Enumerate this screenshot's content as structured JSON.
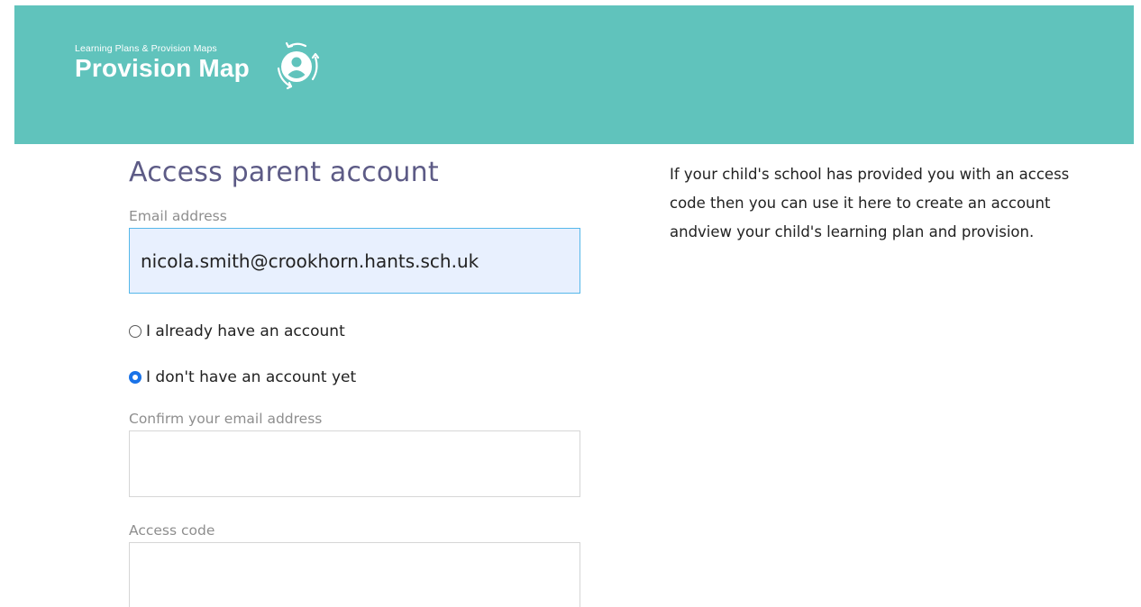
{
  "header": {
    "logo_tagline": "Learning Plans & Provision Maps",
    "logo_title": "Provision Map",
    "background_color": "#60c3bc"
  },
  "form": {
    "title": "Access parent account",
    "email_label": "Email address",
    "email_value": "nicola.smith@crookhorn.hants.sch.uk",
    "account_options": [
      {
        "label": "I already have an account",
        "selected": false
      },
      {
        "label": "I don't have an account yet",
        "selected": true
      }
    ],
    "confirm_email_label": "Confirm your email address",
    "confirm_email_value": "",
    "access_code_label": "Access code",
    "access_code_value": ""
  },
  "info": {
    "lines": [
      "If your child's school has provided you with an access",
      "code then you can use it here to create an account",
      "andview your child's learning plan and provision."
    ]
  },
  "colors": {
    "title": "#5d5b86",
    "label": "#8e8e8e",
    "focused_input_bg": "#e8f0fe",
    "focused_input_border": "#55b7ea",
    "radio_checked": "#1a73e8"
  },
  "icons": {
    "logo": "person-with-circular-arrows-icon"
  }
}
